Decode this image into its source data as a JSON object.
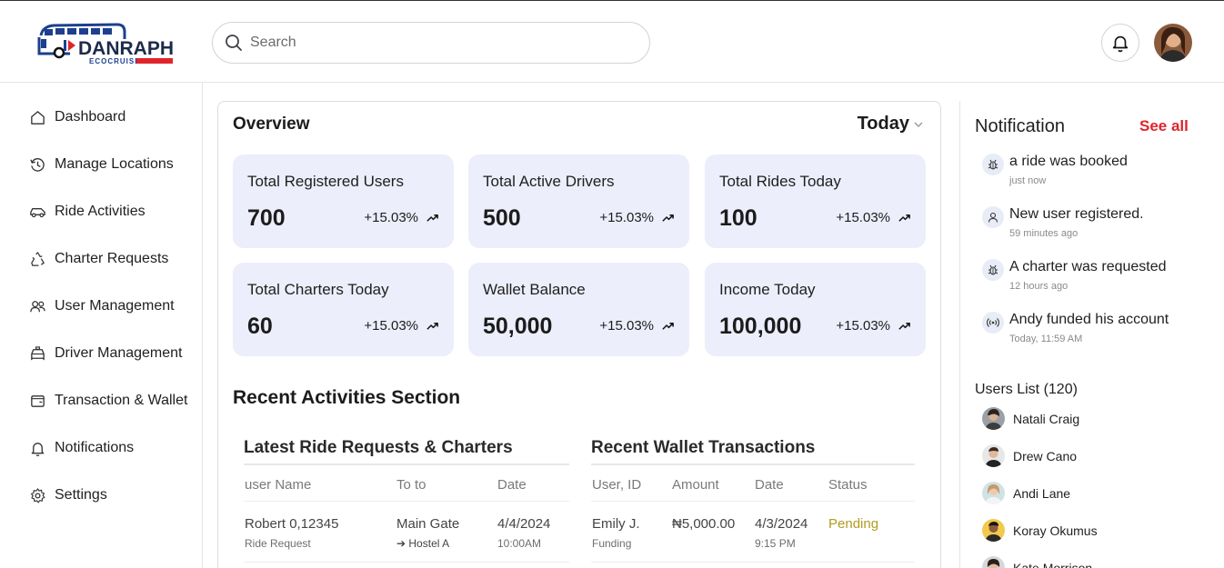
{
  "brand": {
    "name": "DANRAPH",
    "tagline": "ECOCRUISE"
  },
  "search": {
    "placeholder": "Search"
  },
  "sidebar": {
    "items": [
      {
        "label": "Dashboard",
        "icon": "home-icon"
      },
      {
        "label": "Manage Locations",
        "icon": "history-icon"
      },
      {
        "label": "Ride Activities",
        "icon": "car-icon"
      },
      {
        "label": "Charter Requests",
        "icon": "recycle-icon"
      },
      {
        "label": "User Management",
        "icon": "users-icon"
      },
      {
        "label": "Driver Management",
        "icon": "taxi-icon"
      },
      {
        "label": "Transaction & Wallet",
        "icon": "wallet-icon"
      },
      {
        "label": "Notifications",
        "icon": "bell-icon"
      },
      {
        "label": "Settings",
        "icon": "gear-icon"
      }
    ]
  },
  "overview": {
    "title": "Overview",
    "period": "Today",
    "stats": [
      {
        "label": "Total Registered Users",
        "value": "700",
        "change": "+15.03%"
      },
      {
        "label": "Total Active Drivers",
        "value": "500",
        "change": "+15.03%"
      },
      {
        "label": "Total Rides Today",
        "value": "100",
        "change": "+15.03%"
      },
      {
        "label": "Total Charters Today",
        "value": "60",
        "change": "+15.03%"
      },
      {
        "label": "Wallet Balance",
        "value": "50,000",
        "change": "+15.03%"
      },
      {
        "label": "Income Today",
        "value": "100,000",
        "change": "+15.03%"
      }
    ]
  },
  "recent": {
    "title": "Recent Activities Section",
    "rides": {
      "title": "Latest Ride Requests & Charters",
      "headers": [
        "user Name",
        "To to",
        "Date"
      ],
      "rows": [
        {
          "user": "Robert 0,12345",
          "type": "Ride Request",
          "from": "Main Gate",
          "to": "➔ Hostel A",
          "date": "4/4/2024",
          "time": "10:00AM"
        }
      ]
    },
    "wallet": {
      "title": "Recent Wallet Transactions",
      "headers": [
        "User, ID",
        "Amount",
        "Date",
        "Status"
      ],
      "rows": [
        {
          "user": "Emily J.",
          "kind": "Funding",
          "amount": "₦5,000.00",
          "date": "4/3/2024",
          "time": "9:15 PM",
          "status": "Pending"
        }
      ]
    }
  },
  "notifications": {
    "title": "Notification",
    "see_all": "See all",
    "items": [
      {
        "text": "a ride was booked",
        "time": "just now",
        "icon": "bug-icon"
      },
      {
        "text": "New user registered.",
        "time": "59 minutes ago",
        "icon": "user-icon"
      },
      {
        "text": "A charter was requested",
        "time": "12 hours ago",
        "icon": "bug-icon"
      },
      {
        "text": "Andy funded his account",
        "time": "Today, 11:59 AM",
        "icon": "broadcast-icon"
      }
    ]
  },
  "users": {
    "title": "Users List (120)",
    "items": [
      {
        "name": "Natali Craig"
      },
      {
        "name": "Drew Cano"
      },
      {
        "name": "Andi Lane"
      },
      {
        "name": "Koray Okumus"
      },
      {
        "name": "Kate Morrison"
      }
    ]
  },
  "colors": {
    "accent": "#e0242b",
    "card": "#eceefb",
    "pending": "#b39b1f",
    "brand_blue": "#1d3f8f"
  }
}
